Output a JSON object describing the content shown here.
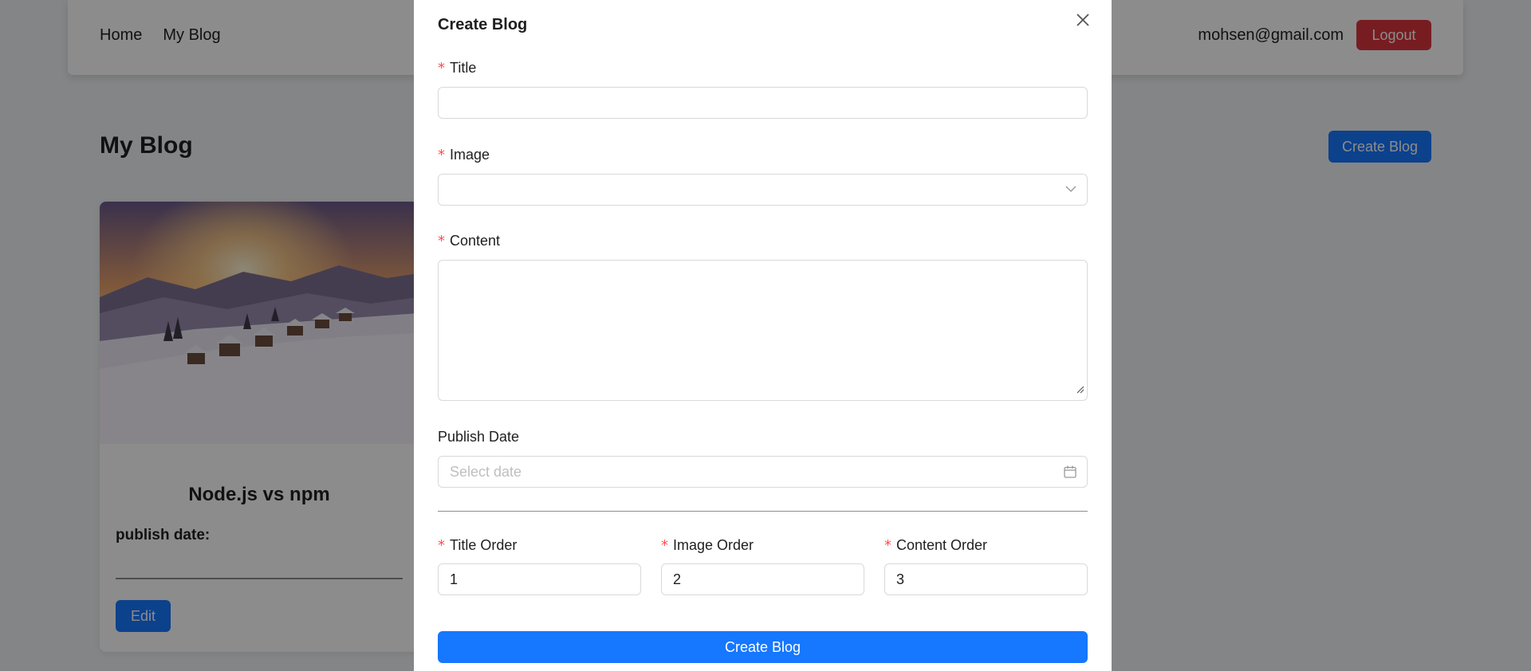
{
  "nav": {
    "links": [
      "Home",
      "My Blog"
    ],
    "user_email": "mohsen@gmail.com",
    "logout_label": "Logout"
  },
  "page": {
    "title": "My Blog",
    "create_button": "Create Blog"
  },
  "blog_card": {
    "title": "Node.js vs npm",
    "publish_date_label": "publish date:",
    "edit_label": "Edit"
  },
  "modal": {
    "title": "Create Blog",
    "fields": {
      "title": {
        "label": "Title",
        "value": ""
      },
      "image": {
        "label": "Image",
        "value": ""
      },
      "content": {
        "label": "Content",
        "value": ""
      },
      "publish_date": {
        "label": "Publish Date",
        "placeholder": "Select date"
      },
      "title_order": {
        "label": "Title Order",
        "value": "1"
      },
      "image_order": {
        "label": "Image Order",
        "value": "2"
      },
      "content_order": {
        "label": "Content Order",
        "value": "3"
      }
    },
    "submit_label": "Create Blog"
  },
  "colors": {
    "primary": "#1677ff",
    "danger": "#d9363e",
    "required": "#ff4d4f"
  },
  "icons": [
    "close-icon",
    "chevron-down-icon",
    "calendar-icon",
    "resize-grip-icon"
  ]
}
